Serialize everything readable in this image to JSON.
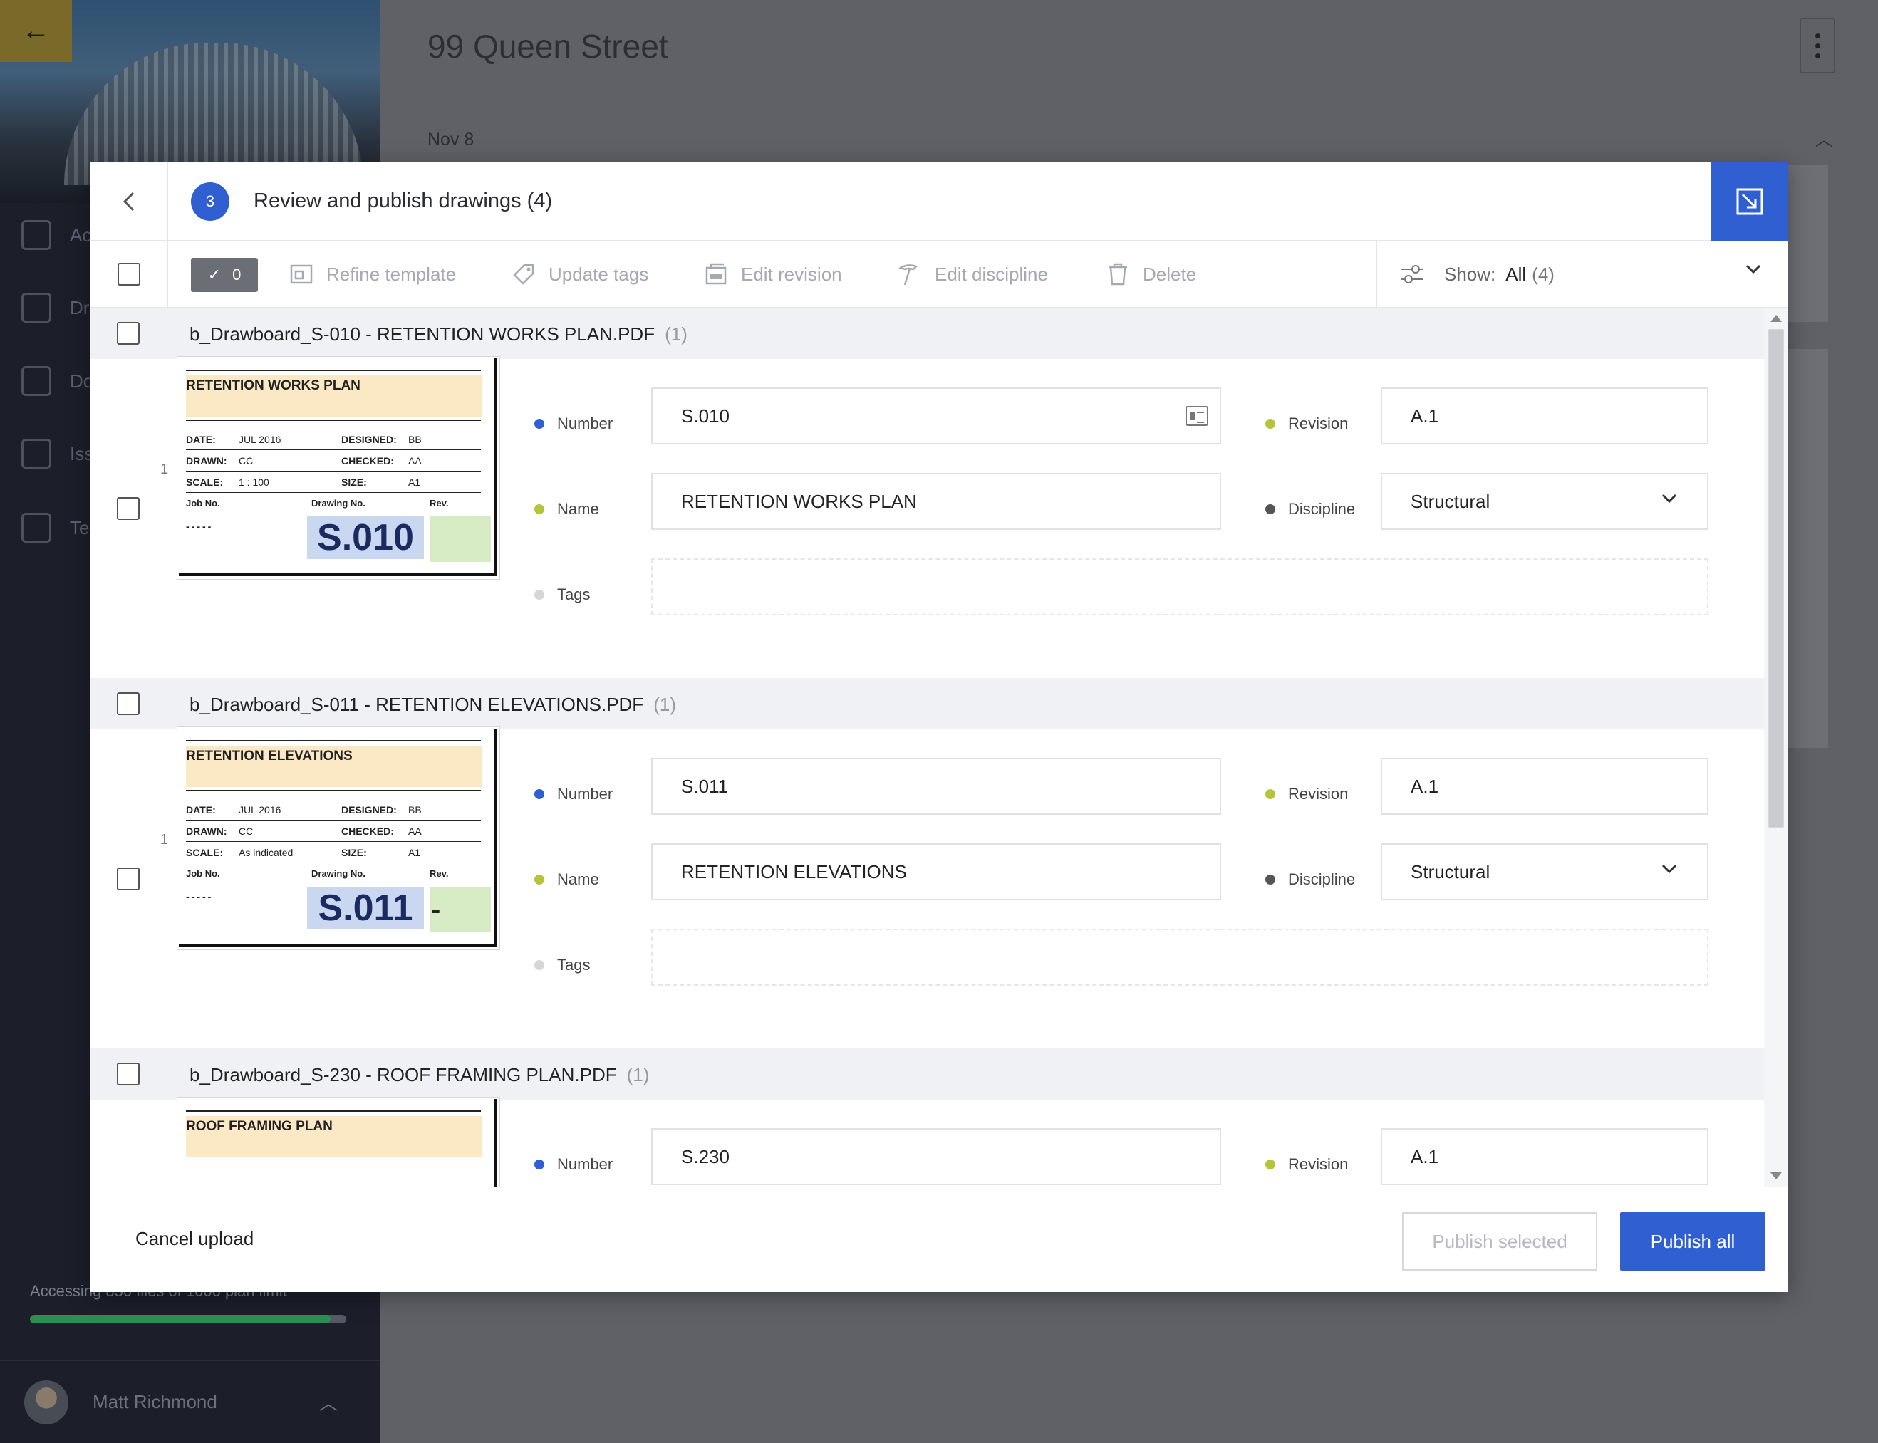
{
  "app": {
    "page_title": "99 Queen Street",
    "date_group": "Nov 8",
    "nav_items": [
      "Ac",
      "Dr",
      "Do",
      "Iss",
      "Te"
    ],
    "plan_limit_text": "Accessing 850 files of 1000 plan limit",
    "plan_usage_fraction": 0.95,
    "user_name": "Matt Richmond"
  },
  "modal": {
    "step": "3",
    "title": "Review and publish drawings (4)",
    "toolbar": {
      "selected_count": "0",
      "refine_template": "Refine template",
      "update_tags": "Update tags",
      "edit_revision": "Edit revision",
      "edit_discipline": "Edit discipline",
      "delete": "Delete",
      "show_label": "Show:",
      "show_value": "All",
      "show_count": "(4)"
    },
    "labels": {
      "number": "Number",
      "revision": "Revision",
      "name": "Name",
      "discipline": "Discipline",
      "tags": "Tags"
    },
    "files": [
      {
        "file_name": "b_Drawboard_S-010 - RETENTION WORKS PLAN.PDF",
        "pages": "(1)",
        "sheet_index": "1",
        "number": "S.010",
        "revision": "A.1",
        "name": "RETENTION WORKS PLAN",
        "discipline": "Structural",
        "thumb": {
          "title": "RETENTION WORKS PLAN",
          "date_label": "DATE:",
          "date": "JUL 2016",
          "designed_label": "DESIGNED:",
          "designed": "BB",
          "drawn_label": "DRAWN:",
          "drawn": "CC",
          "checked_label": "CHECKED:",
          "checked": "AA",
          "scale_label": "SCALE:",
          "scale": "1 : 100",
          "size_label": "SIZE:",
          "size": "A1",
          "job_label": "Job No.",
          "drawing_label": "Drawing No.",
          "rev_label": "Rev.",
          "job_no": "-----",
          "drawing_no": "S.010",
          "rev": ""
        }
      },
      {
        "file_name": "b_Drawboard_S-011 - RETENTION ELEVATIONS.PDF",
        "pages": "(1)",
        "sheet_index": "1",
        "number": "S.011",
        "revision": "A.1",
        "name": "RETENTION ELEVATIONS",
        "discipline": "Structural",
        "thumb": {
          "title": "RETENTION ELEVATIONS",
          "date_label": "DATE:",
          "date": "JUL 2016",
          "designed_label": "DESIGNED:",
          "designed": "BB",
          "drawn_label": "DRAWN:",
          "drawn": "CC",
          "checked_label": "CHECKED:",
          "checked": "AA",
          "scale_label": "SCALE:",
          "scale": "As indicated",
          "size_label": "SIZE:",
          "size": "A1",
          "job_label": "Job No.",
          "drawing_label": "Drawing No.",
          "rev_label": "Rev.",
          "job_no": "-----",
          "drawing_no": "S.011",
          "rev": "-"
        }
      },
      {
        "file_name": "b_Drawboard_S-230 - ROOF FRAMING PLAN.PDF",
        "pages": "(1)",
        "sheet_index": "1",
        "number": "S.230",
        "revision": "A.1",
        "thumb": {
          "title": "ROOF FRAMING PLAN"
        }
      }
    ],
    "footer": {
      "cancel": "Cancel upload",
      "publish_selected": "Publish selected",
      "publish_all": "Publish all"
    }
  },
  "colors": {
    "accent": "#2f5fd0",
    "required_dot": "#2f5fd0",
    "optional_dot": "#b5c43a",
    "discipline_dot": "#555555",
    "tags_dot": "#d6d6d6"
  }
}
